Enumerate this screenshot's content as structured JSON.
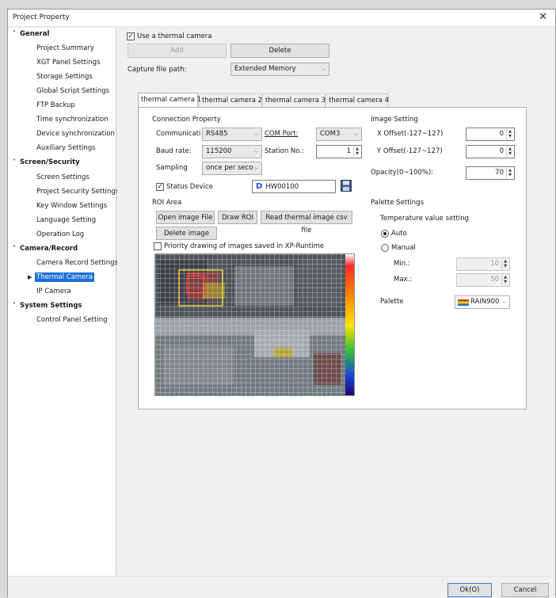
{
  "window": {
    "title": "Project Property",
    "close_glyph": "✕"
  },
  "tree": {
    "general": "General",
    "general_items": [
      "Project Summary",
      "XGT Panel Settings",
      "Storage Settings",
      "Global Script Settings",
      "FTP Backup",
      "Time synchronization",
      "Device synchronization",
      "Auxiliary Settings"
    ],
    "screen": "Screen/Security",
    "screen_items": [
      "Screen Settings",
      "Project Security Settings",
      "Key Window Settings",
      "Language Setting",
      "Operation Log"
    ],
    "camera": "Camera/Record",
    "camera_items": [
      "Camera Record Settings",
      "Thermal Camera",
      "IP Camera"
    ],
    "system": "System Settings",
    "system_items": [
      "Control Panel Setting"
    ],
    "selected": "Thermal Camera"
  },
  "top": {
    "use_thermal_label": "Use a thermal camera",
    "use_thermal_checked": true,
    "add_label": "Add",
    "delete_label": "Delete",
    "capture_path_label": "Capture file path:",
    "capture_path_value": "Extended Memory"
  },
  "tabs": [
    "thermal camera 1",
    "thermal camera 2",
    "thermal camera 3",
    "thermal camera 4"
  ],
  "connection": {
    "header": "Connection Property",
    "comm_label": "Communicati",
    "comm_value": "RS485",
    "com_port_label": "COM Port:",
    "com_port_value": "COM3",
    "baud_label": "Baud rate:",
    "baud_value": "115200",
    "station_label": "Station No.:",
    "station_value": "1",
    "sampling_label": "Sampling",
    "sampling_value": "once per seco",
    "status_device_label": "Status Device",
    "status_device_checked": true,
    "device_prefix": "D",
    "device_value": "HW00100"
  },
  "roi": {
    "header": "ROI Area",
    "open_image": "Open image File",
    "draw_roi": "Draw ROI",
    "read_csv": "Read thermal image csv file",
    "delete_image": "Delete image",
    "priority_label": "Priority drawing of images saved in XP-Runtime",
    "priority_checked": false
  },
  "image_setting": {
    "header": "Image Setting",
    "x_offset_label": "X Offset(-127~127)",
    "x_offset_value": "0",
    "y_offset_label": "Y Offset(-127~127)",
    "y_offset_value": "0",
    "opacity_label": "Opacity(0~100%):",
    "opacity_value": "70"
  },
  "palette": {
    "header": "Palette Settings",
    "temp_header": "Temperature value setting",
    "auto_label": "Auto",
    "manual_label": "Manual",
    "mode": "auto",
    "min_label": "Min.:",
    "min_value": "10",
    "max_label": "Max.:",
    "max_value": "50",
    "palette_label": "Palette",
    "palette_value": "RAIN900"
  },
  "footer": {
    "ok_label": "Ok(O)",
    "cancel_label": "Cancel"
  },
  "colors": {
    "selection": "#1e6fd9",
    "device_prefix": "#1f4fd0",
    "scale_top": "#ffffff",
    "scale_bottom": "#1a0070"
  }
}
